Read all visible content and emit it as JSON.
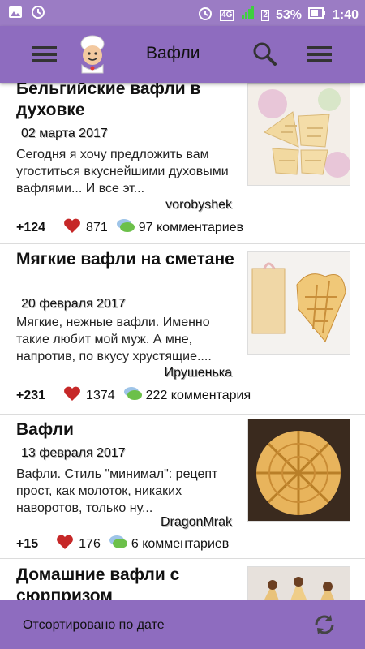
{
  "status_bar": {
    "network": "4G",
    "sim": "2",
    "battery": "53%",
    "time": "1:40"
  },
  "toolbar": {
    "title": "Вафли",
    "menu_icon": "hamburger-menu-icon",
    "search_icon": "search-icon",
    "overflow_icon": "list-menu-icon",
    "logo": "chef-logo"
  },
  "colors": {
    "accent": "#8e6cbf",
    "status": "#9b7cc4",
    "heart": "#c62828",
    "comment": "#6cc04a"
  },
  "recipes": [
    {
      "title": "Бельгийские вафли в духовке",
      "date": "02 марта 2017",
      "desc": "Сегодня я хочу предложить вам угоститься вкуснейшими духовыми вафлями... И все эт...",
      "author": "vorobyshek",
      "rating": "+124",
      "likes": "871",
      "comments": "97 комментариев"
    },
    {
      "title": "Мягкие вафли на сметане",
      "date": "20 февраля 2017",
      "desc": "Мягкие, нежные вафли. Именно такие любит мой муж. А мне, напротив, по вкусу хрустящие....",
      "author": "Ирушенька",
      "rating": "+231",
      "likes": "1374",
      "comments": "222 комментария"
    },
    {
      "title": "Вафли",
      "date": "13 февраля 2017",
      "desc": "Вафли. Стиль \"минимал\": рецепт прост, как молоток, никаких наворотов, только ну...",
      "author": "DragonMrak",
      "rating": "+15",
      "likes": "176",
      "comments": "6 комментариев"
    },
    {
      "title": "Домашние вафли с сюрпризом"
    }
  ],
  "bottom_bar": {
    "sort_label": "Отсортировано по дате",
    "refresh_icon": "refresh-icon"
  }
}
